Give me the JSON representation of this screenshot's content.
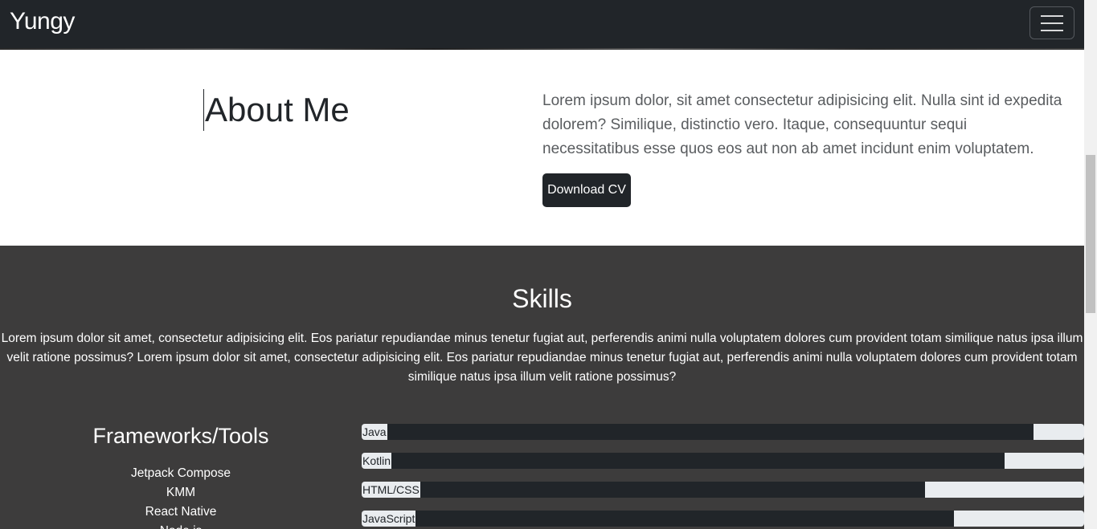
{
  "navbar": {
    "brand": "Yungy",
    "toggler_icon": "hamburger-icon"
  },
  "about": {
    "title": "About Me",
    "text": "Lorem ipsum dolor, sit amet consectetur adipisicing elit. Nulla sint id expedita dolorem? Similique, distinctio vero. Itaque, consequuntur sequi necessitatibus esse quos eos aut non ab amet incidunt enim voluptatem.",
    "cv_button": "Download CV"
  },
  "skills": {
    "title": "Skills",
    "description": "Lorem ipsum dolor sit amet, consectetur adipisicing elit. Eos pariatur repudiandae minus tenetur fugiat aut, perferendis animi nulla voluptatem dolores cum provident totam similique natus ipsa illum velit ratione possimus? Lorem ipsum dolor sit amet, consectetur adipisicing elit. Eos pariatur repudiandae minus tenetur fugiat aut, perferendis animi nulla voluptatem dolores cum provident totam similique natus ipsa illum velit ratione possimus?",
    "frameworks_title": "Frameworks/Tools",
    "frameworks": [
      "Jetpack Compose",
      "KMM",
      "React Native",
      "Node.js"
    ],
    "bars": [
      {
        "label": "Java",
        "percent": 93
      },
      {
        "label": "Kotlin",
        "percent": 89
      },
      {
        "label": "HTML/CSS",
        "percent": 78
      },
      {
        "label": "JavaScript",
        "percent": 82
      }
    ]
  },
  "colors": {
    "nav": "#212529",
    "section_dark": "#3d3c3c",
    "bar_fill": "#212529",
    "bar_track": "#e9ecef"
  }
}
